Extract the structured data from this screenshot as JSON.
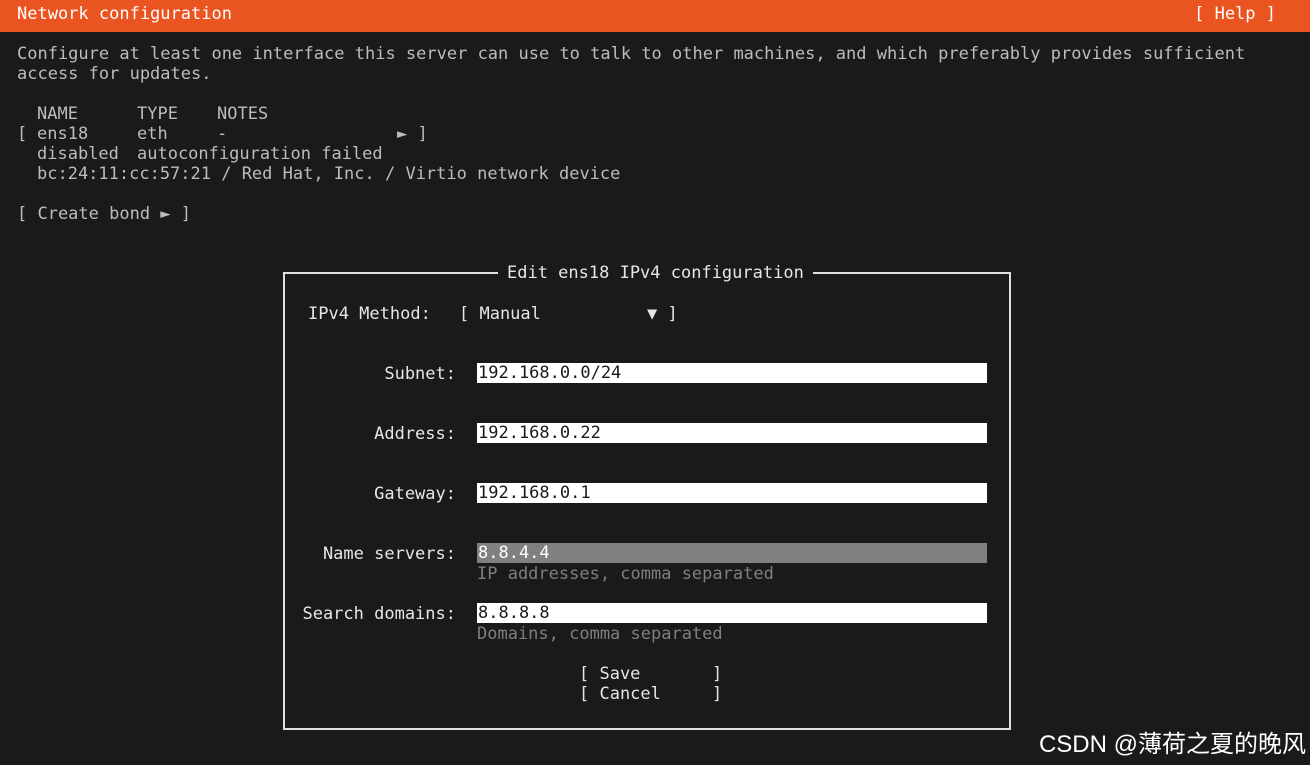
{
  "header": {
    "title": "Network configuration",
    "help": "[ Help ]"
  },
  "intro": {
    "line1": "Configure at least one interface this server can use to talk to other machines, and which preferably provides sufficient",
    "line2": "access for updates."
  },
  "interfaces": {
    "columns": {
      "name": "NAME",
      "type": "TYPE",
      "notes": "NOTES"
    },
    "row": {
      "open_bracket": "[",
      "name": "ens18",
      "type": "eth",
      "notes": "-",
      "arrow": "► ]",
      "status": "disabled",
      "status_note": "autoconfiguration failed",
      "hardware": "bc:24:11:cc:57:21 / Red Hat, Inc. / Virtio network device"
    },
    "create_bond": "[ Create bond ► ]"
  },
  "dialog": {
    "title": "Edit ens18 IPv4 configuration",
    "method_label": "IPv4 Method:",
    "method_open": "[ Manual",
    "method_arrow": "▼ ]",
    "subnet_label": "Subnet:",
    "subnet_value": "192.168.0.0/24",
    "address_label": "Address:",
    "address_value": "192.168.0.22",
    "gateway_label": "Gateway:",
    "gateway_value": "192.168.0.1",
    "nameservers_label": "Name servers:",
    "nameservers_value": "8.8.4.4",
    "nameservers_hint": "IP addresses, comma separated",
    "search_label": "Search domains:",
    "search_value": "8.8.8.8",
    "search_hint": "Domains, comma separated",
    "save_button": "[ Save       ]",
    "cancel_button": "[ Cancel     ]"
  },
  "watermark": "CSDN @薄荷之夏的晚风",
  "colors": {
    "accent": "#e95420",
    "background": "#1a1a1a",
    "field": "#ffffff",
    "focused_field": "#808080"
  }
}
